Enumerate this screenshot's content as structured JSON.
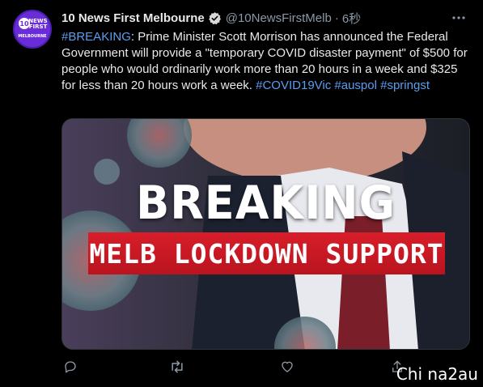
{
  "tweet": {
    "display_name": "10 News First Melbourne",
    "handle": "@10NewsFirstMelb",
    "separator": "·",
    "time": "6秒",
    "text": {
      "hashtag_breaking": "#BREAKING",
      "main": ": Prime Minister Scott Morrison has announced the Federal Government will provide a \"temporary COVID disaster payment\" of $500 for people who would ordinarily work more than 20 hours in a week and $325 for less than 20 hours work a week. ",
      "hashtag_covid": "#COVID19Vic",
      "hashtag_auspol": "#auspol",
      "hashtag_springst": "#springst"
    }
  },
  "avatar": {
    "line1": "NEWS",
    "line2": "FIRST",
    "line3": "MELBOURNE",
    "number": "10"
  },
  "media": {
    "headline": "BREAKING",
    "banner": "MELB LOCKDOWN SUPPORT"
  },
  "actions": [
    "reply-icon",
    "retweet-icon",
    "like-icon",
    "share-icon"
  ],
  "watermark": "Chi na2au",
  "colors": {
    "background": "#000000",
    "link": "#5b9ef0",
    "verified": "#d9d9d9",
    "avatar": "#6a2bd9",
    "banner": "#d81e2a",
    "muted": "#8b98a5"
  }
}
